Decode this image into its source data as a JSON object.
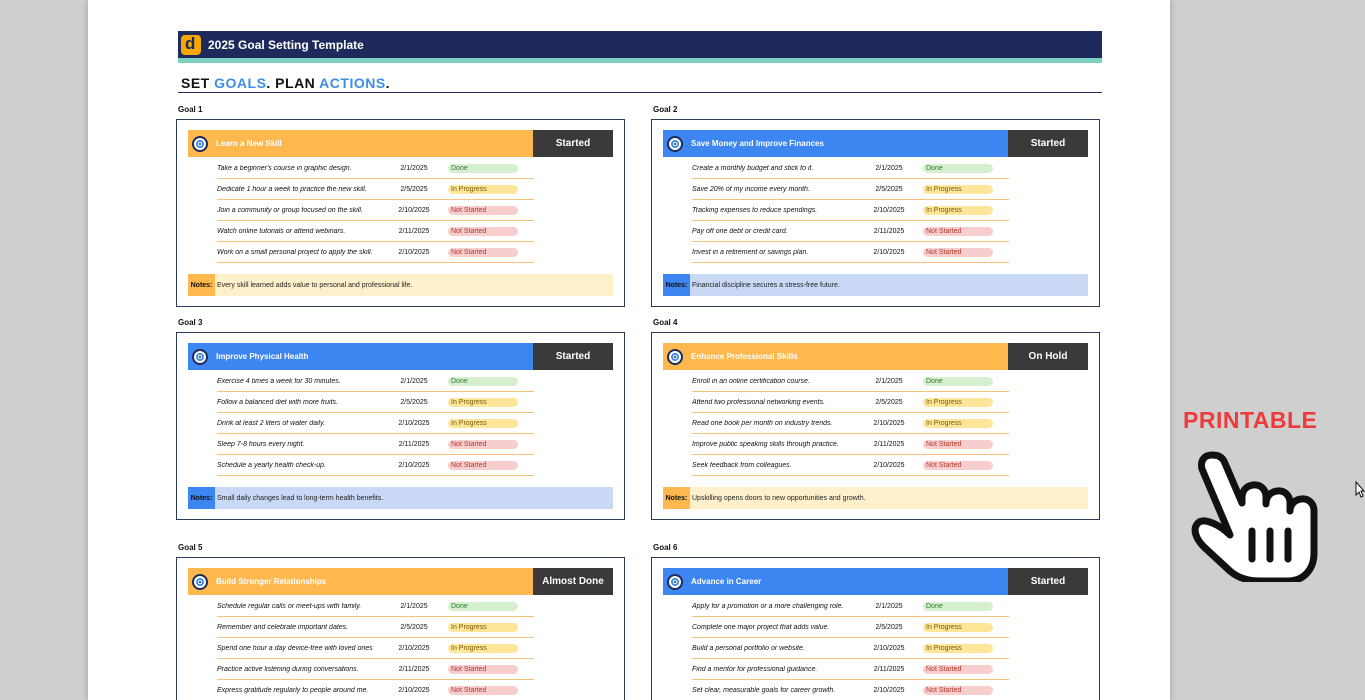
{
  "header": {
    "title": "2025 Goal Setting Template",
    "logo": "d"
  },
  "tagline": {
    "set": "SET ",
    "goals": "GOALS",
    "dot1": ". PLAN ",
    "actions": "ACTIONS",
    "dot2": "."
  },
  "colors": {
    "orange": "#ffb84d",
    "blue": "#3d85f0",
    "navy": "#1f2a5c",
    "teal": "#7ed3c0",
    "notes_orange": "#fff0cc",
    "notes_blue": "#c9d8f5"
  },
  "notes_label": "Notes:",
  "goals": [
    {
      "label": "Goal 1",
      "title": "Learn a New Skill",
      "status": "Started",
      "theme": "orange",
      "tasks": [
        {
          "text": "Take a beginner's course in graphic design.",
          "date": "2/1/2025",
          "state": "Done"
        },
        {
          "text": "Dedicate 1 hour a week to practice the new skill.",
          "date": "2/5/2025",
          "state": "In Progress"
        },
        {
          "text": "Join a community or group focused on the skill.",
          "date": "2/10/2025",
          "state": "Not Started"
        },
        {
          "text": "Watch online tutorials or attend webinars.",
          "date": "2/11/2025",
          "state": "Not Started"
        },
        {
          "text": "Work on a small personal project to apply the skill.",
          "date": "2/10/2025",
          "state": "Not Started"
        }
      ],
      "notes": "Every skill learned adds value to personal and professional life."
    },
    {
      "label": "Goal 2",
      "title": "Save Money and Improve Finances",
      "status": "Started",
      "theme": "blue",
      "tasks": [
        {
          "text": "Create a monthly budget and stick to it.",
          "date": "2/1/2025",
          "state": "Done"
        },
        {
          "text": "Save 20% of my income every month.",
          "date": "2/5/2025",
          "state": "In Progress"
        },
        {
          "text": "Tracking expenses to reduce spendings.",
          "date": "2/10/2025",
          "state": "In Progress"
        },
        {
          "text": "Pay off one debt or credit card.",
          "date": "2/11/2025",
          "state": "Not Started"
        },
        {
          "text": "Invest in a retirement or savings plan.",
          "date": "2/10/2025",
          "state": "Not Started"
        }
      ],
      "notes": "Financial discipline secures a stress-free future."
    },
    {
      "label": "Goal 3",
      "title": "Improve Physical Health",
      "status": "Started",
      "theme": "blue",
      "tasks": [
        {
          "text": "Exercise 4 times a week for 30 minutes.",
          "date": "2/1/2025",
          "state": "Done"
        },
        {
          "text": "Follow a balanced diet with more fruits.",
          "date": "2/5/2025",
          "state": "In Progress"
        },
        {
          "text": "Drink at least 2 liters of water daily.",
          "date": "2/10/2025",
          "state": "In Progress"
        },
        {
          "text": "Sleep 7-8 hours every night.",
          "date": "2/11/2025",
          "state": "Not Started"
        },
        {
          "text": "Schedule a yearly health check-up.",
          "date": "2/10/2025",
          "state": "Not Started"
        }
      ],
      "notes": "Small daily changes lead to long-term health benefits."
    },
    {
      "label": "Goal 4",
      "title": "Enhance Professional Skills",
      "status": "On Hold",
      "theme": "orange",
      "tasks": [
        {
          "text": "Enroll in an online certification course.",
          "date": "2/1/2025",
          "state": "Done"
        },
        {
          "text": "Attend two professional networking events.",
          "date": "2/5/2025",
          "state": "In Progress"
        },
        {
          "text": "Read one book per month on industry trends.",
          "date": "2/10/2025",
          "state": "In Progress"
        },
        {
          "text": "Improve public speaking skills through practice.",
          "date": "2/11/2025",
          "state": "Not Started"
        },
        {
          "text": "Seek feedback from colleagues.",
          "date": "2/10/2025",
          "state": "Not Started"
        }
      ],
      "notes": "Upskilling opens doors to new opportunities and growth."
    },
    {
      "label": "Goal 5",
      "title": "Build Stronger Relationships",
      "status": "Almost Done",
      "theme": "orange",
      "tasks": [
        {
          "text": "Schedule regular calls or meet-ups with family.",
          "date": "2/1/2025",
          "state": "Done"
        },
        {
          "text": "Remember and celebrate important dates.",
          "date": "2/5/2025",
          "state": "In Progress"
        },
        {
          "text": "Spend one hour a day device-free with loved ones",
          "date": "2/10/2025",
          "state": "In Progress"
        },
        {
          "text": "Practice active listening during conversations.",
          "date": "2/11/2025",
          "state": "Not Started"
        },
        {
          "text": "Express gratitude regularly to people around me.",
          "date": "2/10/2025",
          "state": "Not Started"
        }
      ],
      "notes": ""
    },
    {
      "label": "Goal 6",
      "title": "Advance in Career",
      "status": "Started",
      "theme": "blue",
      "tasks": [
        {
          "text": "Apply for a promotion or a more challenging role.",
          "date": "2/1/2025",
          "state": "Done"
        },
        {
          "text": "Complete one major project that adds value.",
          "date": "2/5/2025",
          "state": "In Progress"
        },
        {
          "text": "Build a personal portfolio or website.",
          "date": "2/10/2025",
          "state": "In Progress"
        },
        {
          "text": "Find a mentor for professional guidance.",
          "date": "2/11/2025",
          "state": "Not Started"
        },
        {
          "text": "Set clear, measurable goals for career growth.",
          "date": "2/10/2025",
          "state": "Not Started"
        }
      ],
      "notes": ""
    }
  ],
  "promo": {
    "label": "PRINTABLE",
    "icon": "hand-pointer-icon"
  }
}
